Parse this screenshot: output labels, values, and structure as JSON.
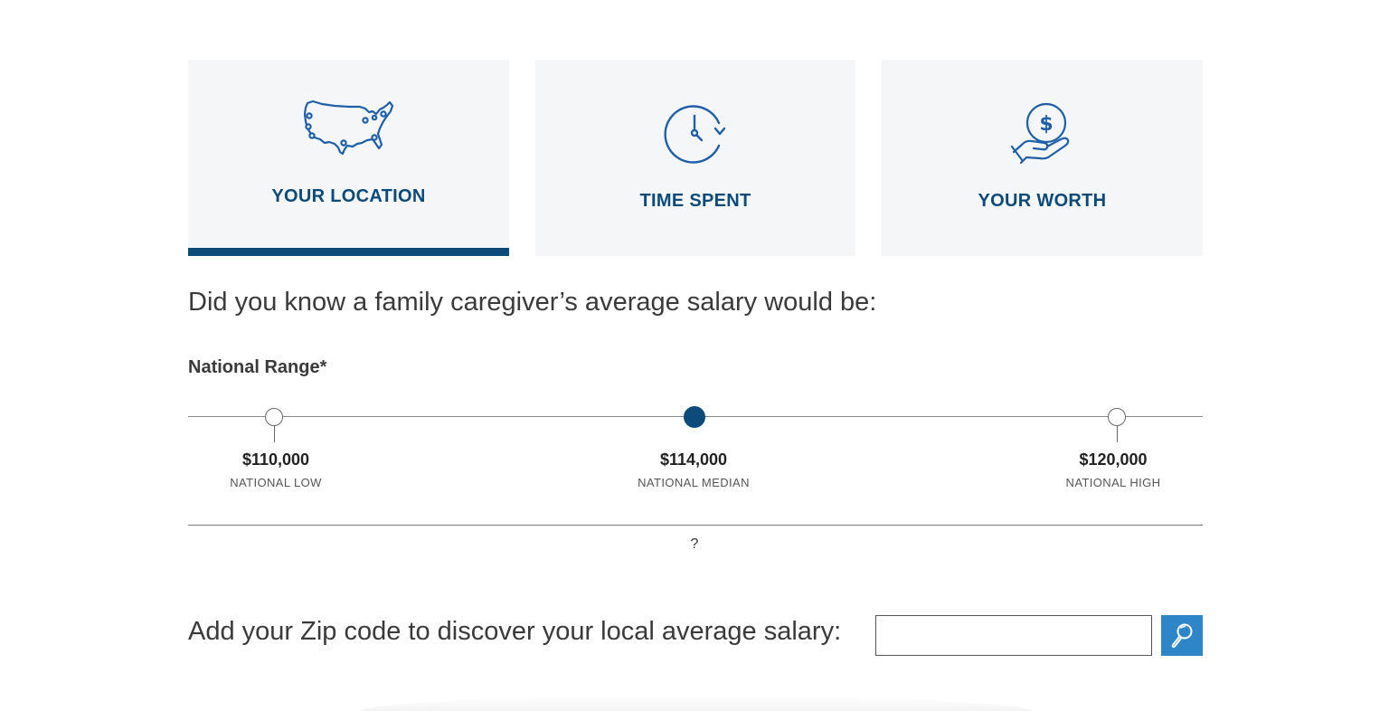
{
  "tabs": [
    {
      "label": "YOUR LOCATION",
      "icon": "usa-map-icon",
      "active": true
    },
    {
      "label": "TIME SPENT",
      "icon": "clock-icon",
      "active": false
    },
    {
      "label": "YOUR WORTH",
      "icon": "hand-coin-icon",
      "active": false
    }
  ],
  "question": "Did you know a family caregiver’s average salary would be:",
  "range": {
    "title": "National Range*",
    "low": {
      "value": "$110,000",
      "label": "NATIONAL LOW"
    },
    "median": {
      "value": "$114,000",
      "label": "NATIONAL MEDIAN"
    },
    "high": {
      "value": "$120,000",
      "label": "NATIONAL HIGH"
    }
  },
  "help_label": "?",
  "zip": {
    "prompt": "Add your Zip code to discover your local average salary:",
    "value": "",
    "placeholder": "",
    "search_icon": "search-icon"
  },
  "colors": {
    "brand": "#0c4a7a",
    "tab_bg": "#f5f6f8",
    "button": "#2e86c9",
    "icon": "#1f5fa8"
  }
}
